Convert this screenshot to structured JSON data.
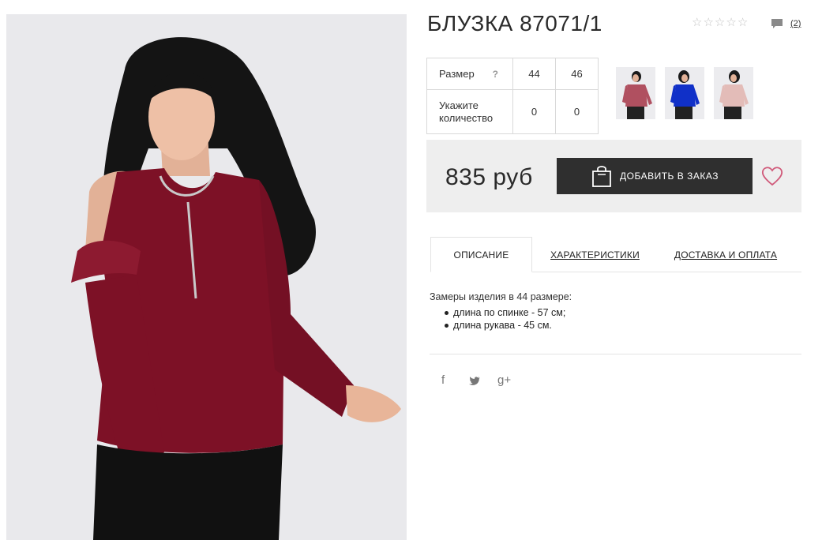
{
  "product": {
    "title": "БЛУЗКА 87071/1",
    "rating_stars": 0,
    "rating_max": 5,
    "comments_count": "(2)"
  },
  "sizes": {
    "size_label": "Размер",
    "help": "?",
    "size_values": [
      "44",
      "46"
    ],
    "qty_label_line1": "Укажите",
    "qty_label_line2": "количество",
    "qty_values": [
      "0",
      "0"
    ]
  },
  "color_variants": [
    {
      "color": "#b05060"
    },
    {
      "color": "#1030c8"
    },
    {
      "color": "#e3bcb8"
    }
  ],
  "purchase": {
    "price": "835 руб",
    "add_button": "ДОБАВИТЬ В ЗАКАЗ"
  },
  "tabs": [
    {
      "label": "ОПИСАНИЕ",
      "active": true
    },
    {
      "label": "ХАРАКТЕРИСТИКИ",
      "active": false
    },
    {
      "label": "ДОСТАВКА И ОПЛАТА",
      "active": false
    }
  ],
  "description": {
    "title": "Замеры изделия в 44 размере:",
    "items": [
      "длина по спинке - 57 см;",
      "длина рукава - 45 см."
    ]
  },
  "social": {
    "facebook": "f",
    "twitter": "twitter-icon",
    "google_plus": "g+"
  },
  "colors": {
    "blouse": "#7d1126",
    "price_bg": "#eeeeee",
    "button_bg": "#2f2f2f",
    "heart": "#d05a7a"
  }
}
